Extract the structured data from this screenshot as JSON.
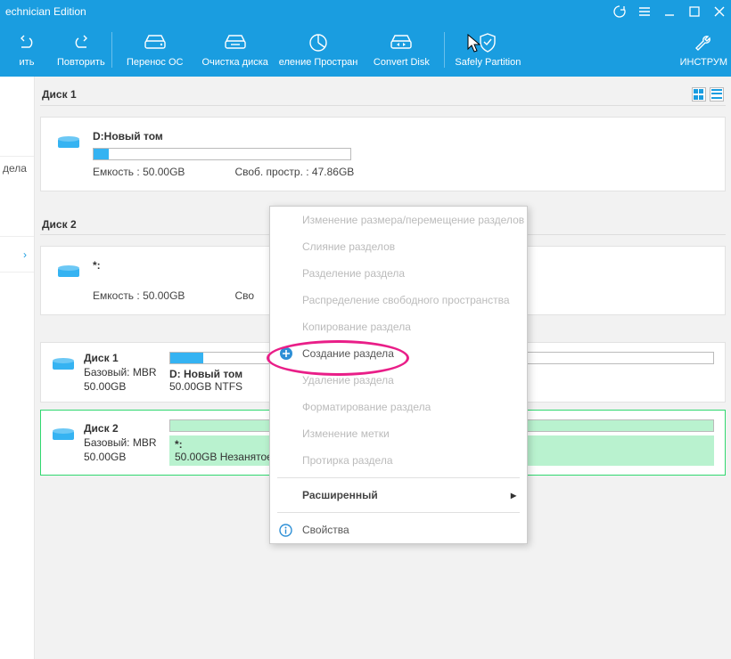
{
  "titlebar": {
    "title": "echnician Edition"
  },
  "toolbar": {
    "undo": "ить",
    "redo": "Повторить",
    "migrate": "Перенос ОС",
    "cleanup": "Очистка диска",
    "space": "еление Простран",
    "convert": "Convert Disk",
    "safely": "Safely Partition",
    "tools": "ИНСТРУМ"
  },
  "sidebar": {
    "item1": "",
    "item2": "дела"
  },
  "disk1": {
    "header": "Диск 1",
    "partition_name": "D:Новый том",
    "capacity_label": "Емкость : 50.00GB",
    "free_label": "Своб. простр. : 47.86GB",
    "fill_pct": 6
  },
  "disk2": {
    "header": "Диск 2",
    "partition_name": "*:",
    "capacity_label": "Емкость : 50.00GB",
    "free_label": "Сво"
  },
  "list": {
    "row1": {
      "name": "Диск 1",
      "type": "Базовый: MBR",
      "size": "50.00GB",
      "part_name": "D: Новый том",
      "part_detail": "50.00GB NTFS",
      "fill_pct": 6
    },
    "row2": {
      "name": "Диск 2",
      "type": "Базовый: MBR",
      "size": "50.00GB",
      "part_name": "*:",
      "part_detail": "50.00GB Незанятое"
    }
  },
  "menu": {
    "resize": "Изменение размера/перемещение разделов",
    "merge": "Слияние разделов",
    "split": "Разделение раздела",
    "allocate": "Распределение свободного пространства",
    "copy": "Копирование раздела",
    "create": "Создание раздела",
    "delete": "Удаление раздела",
    "format": "Форматирование раздела",
    "label": "Изменение метки",
    "wipe": "Протирка раздела",
    "advanced": "Расширенный",
    "props": "Свойства"
  }
}
